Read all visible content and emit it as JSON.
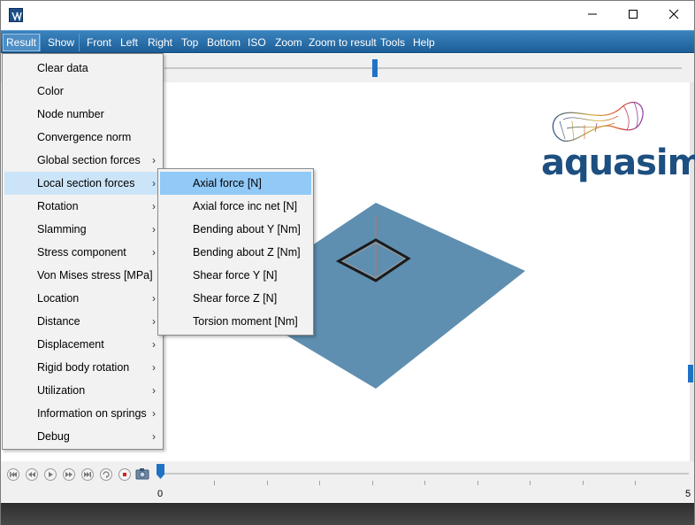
{
  "menubar": {
    "items": [
      "Result",
      "Show",
      "Front",
      "Left",
      "Right",
      "Top",
      "Bottom",
      "ISO",
      "Zoom",
      "Zoom to result",
      "Tools",
      "Help"
    ]
  },
  "logo": {
    "text": "aquasim"
  },
  "result_menu": {
    "items": [
      {
        "label": "Clear data",
        "submenu": false
      },
      {
        "label": "Color",
        "submenu": false
      },
      {
        "label": "Node number",
        "submenu": false
      },
      {
        "label": "Convergence norm",
        "submenu": false
      },
      {
        "label": "Global section forces",
        "submenu": true
      },
      {
        "label": "Local section forces",
        "submenu": true
      },
      {
        "label": "Rotation",
        "submenu": true
      },
      {
        "label": "Slamming",
        "submenu": true
      },
      {
        "label": "Stress component",
        "submenu": true
      },
      {
        "label": "Von Mises stress [MPa]",
        "submenu": false
      },
      {
        "label": "Location",
        "submenu": true
      },
      {
        "label": "Distance",
        "submenu": true
      },
      {
        "label": "Displacement",
        "submenu": true
      },
      {
        "label": "Rigid body rotation",
        "submenu": true
      },
      {
        "label": "Utilization",
        "submenu": true
      },
      {
        "label": "Information on springs",
        "submenu": true
      },
      {
        "label": "Debug",
        "submenu": true
      }
    ],
    "highlighted": "Local section forces"
  },
  "local_section_forces_menu": {
    "items": [
      "Axial force [N]",
      "Axial force inc net [N]",
      "Bending about Y [Nm]",
      "Bending about Z [Nm]",
      "Shear force Y [N]",
      "Shear force Z [N]",
      "Torsion moment [Nm]"
    ],
    "highlighted": "Axial force [N]"
  },
  "timeline": {
    "start_label": "0",
    "end_label": "5"
  },
  "colors": {
    "menubar": "#2a6ea8",
    "accent": "#1f73c6",
    "plane": "#5f8fb0",
    "highlight": "#91c9f7"
  },
  "icons": [
    "app-icon",
    "minimize-icon",
    "maximize-icon",
    "close-icon",
    "first-frame-icon",
    "rewind-icon",
    "play-icon",
    "fast-forward-icon",
    "last-frame-icon",
    "loop-icon",
    "stop-icon",
    "camera-icon"
  ]
}
